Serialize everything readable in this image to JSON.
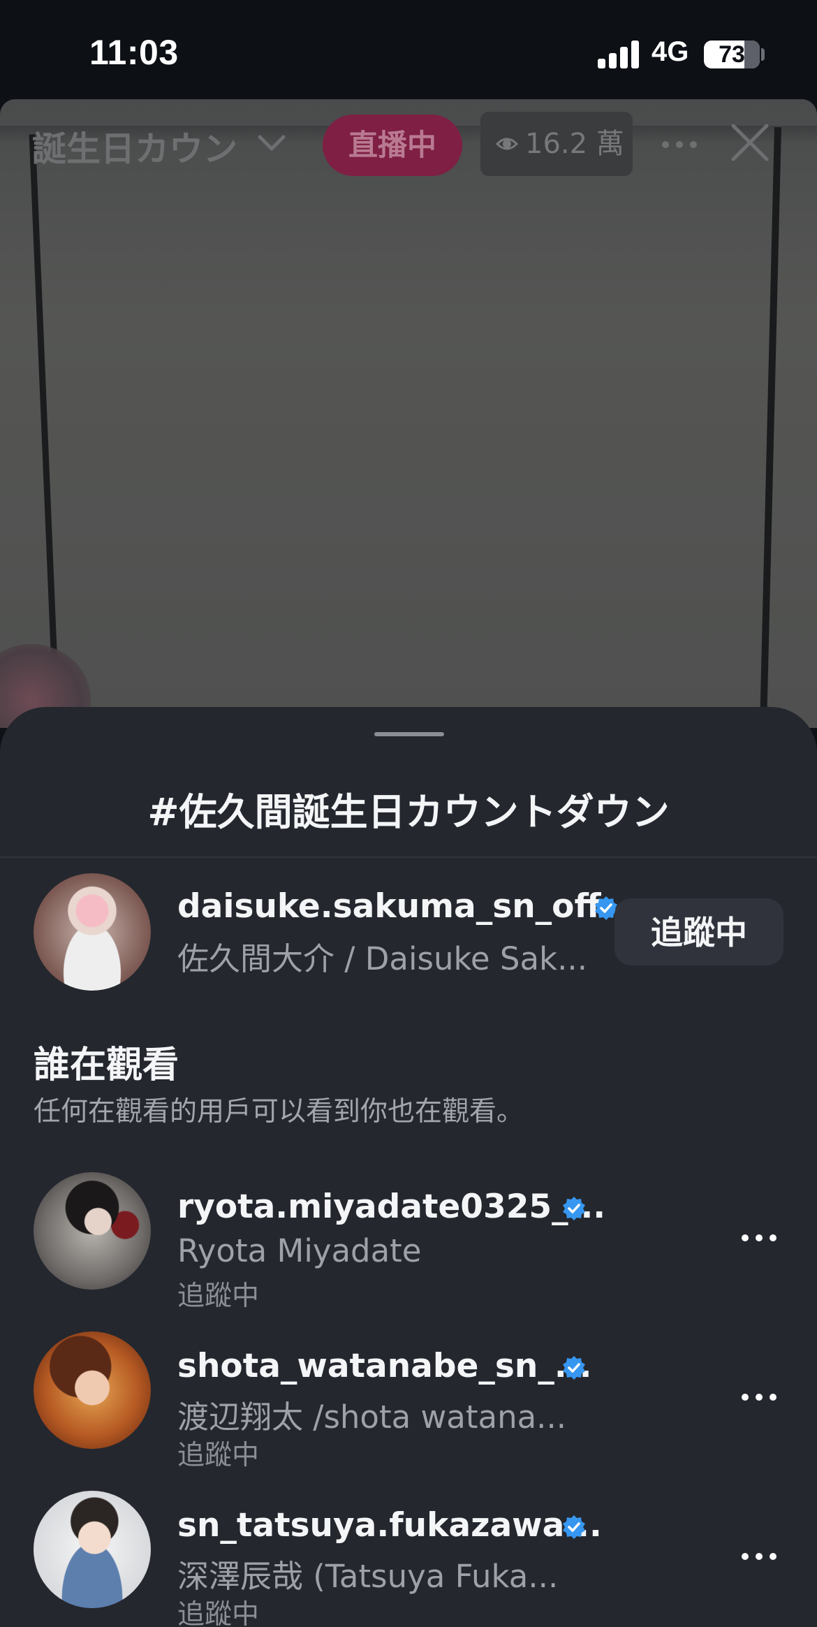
{
  "status_bar": {
    "time": "11:03",
    "network": "4G",
    "battery": "73"
  },
  "live": {
    "title": "誕生日カウン",
    "live_badge": "直播中",
    "viewer_count": "16.2 萬",
    "icons": [
      "chevron-down-icon",
      "eye-icon",
      "more-icon",
      "close-icon"
    ]
  },
  "sheet": {
    "title": "#佐久間誕生日カウントダウン",
    "host": {
      "username": "daisuke.sakuma_sn_off...",
      "display_name": "佐久間大介 / Daisuke Sak...",
      "verified": true,
      "follow_label": "追蹤中"
    },
    "watchers_section": {
      "heading": "誰在觀看",
      "description": "任何在觀看的用戶可以看到你也在觀看。"
    },
    "watchers": [
      {
        "username": "ryota.miyadate0325_...",
        "display_name": "Ryota Miyadate",
        "status": "追蹤中",
        "verified": true
      },
      {
        "username": "shota_watanabe_sn_...",
        "display_name": "渡辺翔太 /shota watana...",
        "status": "追蹤中",
        "verified": true
      },
      {
        "username": "sn_tatsuya.fukazawa...",
        "display_name": "深澤辰哉 (Tatsuya Fuka...",
        "status": "追蹤中",
        "verified": true
      }
    ]
  },
  "colors": {
    "sheet_background": "#24272e",
    "live_badge": "#7e1f43",
    "verified_badge": "#3797f0"
  }
}
